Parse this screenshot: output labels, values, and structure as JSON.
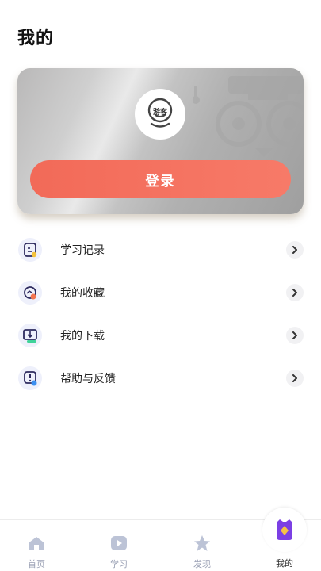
{
  "header": {
    "title": "我的"
  },
  "profile": {
    "avatar_text": "游客",
    "login_label": "登录"
  },
  "menu": [
    {
      "label": "学习记录",
      "icon": "study-record-icon"
    },
    {
      "label": "我的收藏",
      "icon": "favorites-icon"
    },
    {
      "label": "我的下载",
      "icon": "download-icon"
    },
    {
      "label": "帮助与反馈",
      "icon": "help-feedback-icon"
    }
  ],
  "tabbar": {
    "tabs": [
      {
        "label": "首页",
        "icon": "home-icon"
      },
      {
        "label": "学习",
        "icon": "play-icon"
      },
      {
        "label": "发现",
        "icon": "star-icon"
      },
      {
        "label": "我的",
        "icon": "owl-icon",
        "active": true
      }
    ]
  },
  "colors": {
    "login_button": "#f26a58",
    "tab_inactive": "#9aa0b4",
    "active_tab_icon": "#7b3fe4"
  }
}
